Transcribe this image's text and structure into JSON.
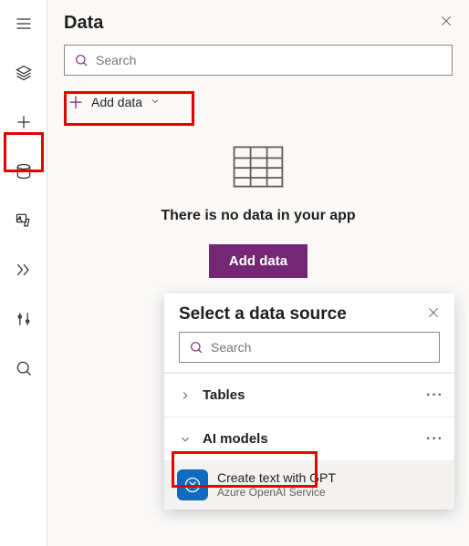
{
  "panel": {
    "title": "Data",
    "search_placeholder": "Search",
    "add_data_label": "Add data",
    "empty_text": "There is no data in your app",
    "add_data_button": "Add data"
  },
  "popover": {
    "title": "Select a data source",
    "search_placeholder": "Search",
    "categories": [
      {
        "label": "Tables",
        "expanded": false
      },
      {
        "label": "AI models",
        "expanded": true
      }
    ],
    "item": {
      "title": "Create text with GPT",
      "subtitle": "Azure OpenAI Service"
    }
  },
  "colors": {
    "accent": "#742774",
    "item_icon_bg": "#0f6cbd",
    "highlight": "#e60000"
  }
}
